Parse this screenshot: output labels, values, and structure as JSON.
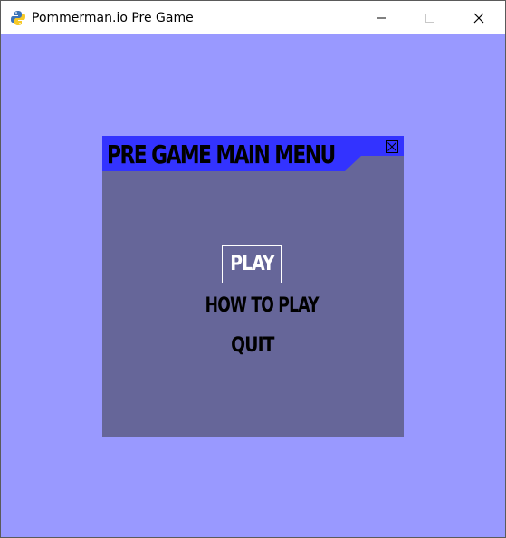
{
  "window": {
    "title": "Pommerman.io Pre Game",
    "app_icon": "python-snake-icon",
    "controls": [
      "minimize-icon",
      "maximize-icon",
      "close-icon"
    ]
  },
  "colors": {
    "background": "#9999ff",
    "panel": "#666699",
    "header": "#3333ff",
    "selected_text": "#ffffff",
    "text": "#000000"
  },
  "menu": {
    "title": "PRE GAME MAIN MENU",
    "close_icon": "x-box-icon",
    "items": [
      {
        "label": "PLAY",
        "selected": true
      },
      {
        "label": "HOW TO PLAY",
        "selected": false
      },
      {
        "label": "QUIT",
        "selected": false
      }
    ]
  }
}
